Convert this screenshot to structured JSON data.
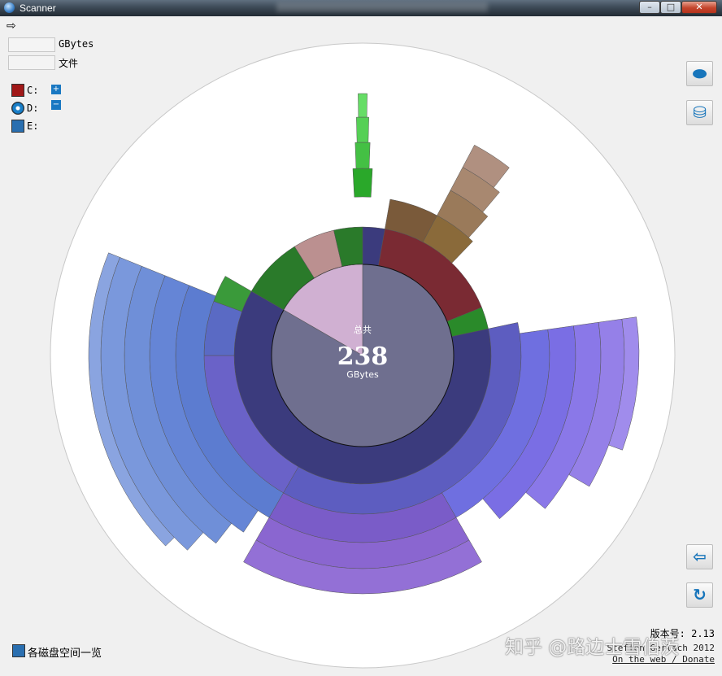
{
  "window": {
    "title": "Scanner"
  },
  "stats": {
    "size_unit_label": "GBytes",
    "files_label": "文件"
  },
  "drives": [
    {
      "label": "C:",
      "color": "#a01818"
    },
    {
      "label": "D:",
      "color": "#1a7fc8"
    },
    {
      "label": "E:",
      "color": "#2a6fb0"
    }
  ],
  "chart": {
    "center_caption": "总共",
    "center_total": "238",
    "center_unit": "GBytes"
  },
  "footer": {
    "overview_label": "各磁盘空间一览",
    "version_text": "版本号: 2.13",
    "links_line1": "Steffen Gerlach 2012",
    "links_line2": "On the web / Donate",
    "watermark": "知乎 @路边士雪伯茨"
  },
  "icons": {
    "expand_arrow": "arrow-right-icon",
    "toolbar_top": "disk-icon",
    "toolbar_second": "delete-bin-icon",
    "toolbar_back": "back-arrow-icon",
    "toolbar_refresh": "refresh-icon"
  }
}
